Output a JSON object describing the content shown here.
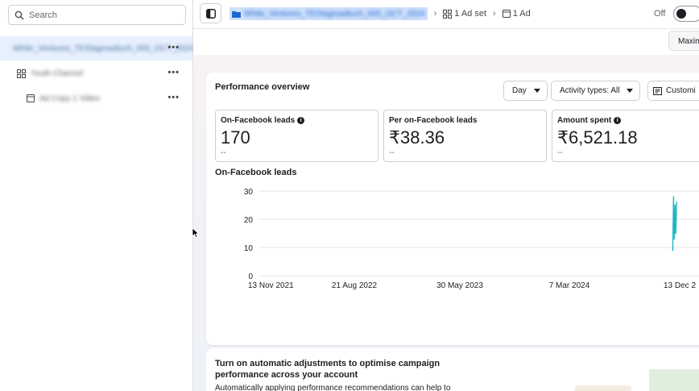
{
  "search": {
    "placeholder": "Search"
  },
  "sidebar": {
    "items": [
      {
        "level": "campaign",
        "label": "White_Ventures_TEStagreadiuch_000_OCT_2024"
      },
      {
        "level": "adset",
        "label": "Youth Channel"
      },
      {
        "level": "ad",
        "label": "Ad Copy 1 Video"
      }
    ],
    "more_label": "•••"
  },
  "topbar": {
    "campaign_crumb": "White_Ventures_TEStagreadiuch_000_OCT_2024",
    "adset_crumb": "1 Ad set",
    "ad_crumb": "1 Ad",
    "toggle_label": "Off",
    "toggle_state": "off"
  },
  "subbar": {
    "maximise_label": "Maxim"
  },
  "performance": {
    "title": "Performance overview",
    "day_label": "Day",
    "activity_label": "Activity types: All",
    "customise_label": "Customi",
    "metrics": [
      {
        "label": "On-Facebook leads",
        "value": "170",
        "delta": "--"
      },
      {
        "label": "Per on-Facebook leads",
        "value": "₹38.36",
        "delta": "--"
      },
      {
        "label": "Amount spent",
        "value": "₹6,521.18",
        "delta": "--"
      }
    ]
  },
  "chart_data": {
    "type": "line",
    "title": "On-Facebook leads",
    "xlabel": "",
    "ylabel": "",
    "ylim": [
      0,
      30
    ],
    "yticks": [
      "30",
      "20",
      "10",
      "0"
    ],
    "xticks": [
      "13 Nov 2021",
      "21 Aug 2022",
      "30 May 2023",
      "7 Mar 2024",
      "13 Dec 2"
    ],
    "grid": true,
    "color": "#1fb5c4",
    "series": [
      {
        "values": [
          {
            "x": "Nov 25 2024",
            "y": 9
          },
          {
            "x": "Nov 27 2024",
            "y": 28
          },
          {
            "x": "Nov 29 2024",
            "y": 13
          },
          {
            "x": "Dec 1 2024",
            "y": 25
          },
          {
            "x": "Dec 3 2024",
            "y": 15
          },
          {
            "x": "Dec 5 2024",
            "y": 26
          }
        ]
      }
    ]
  },
  "recommendation": {
    "title": "Turn on automatic adjustments to optimise campaign performance across your account",
    "text": "Automatically applying performance recommendations can help to"
  }
}
